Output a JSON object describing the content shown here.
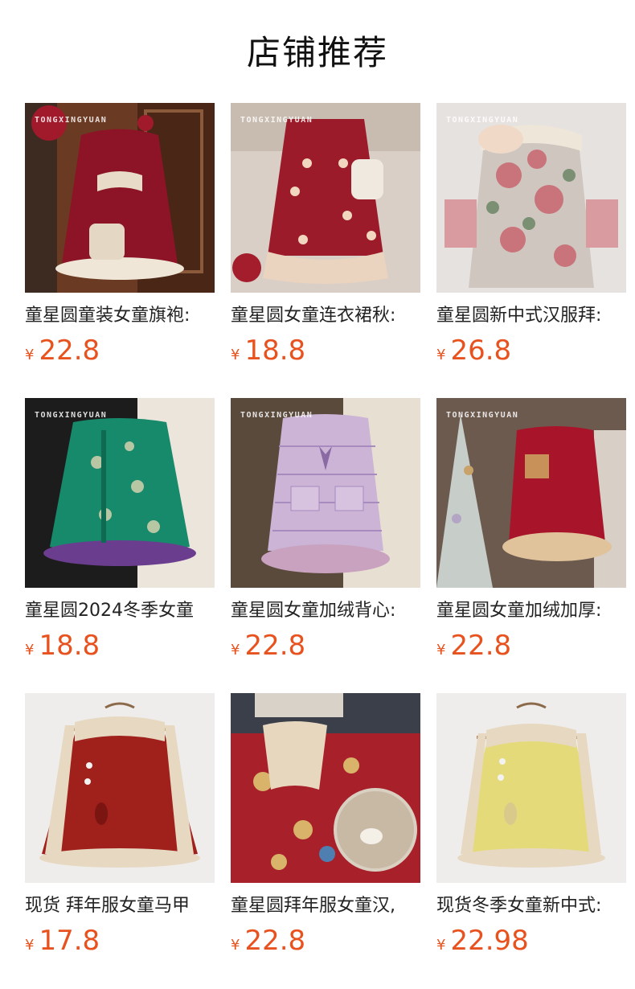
{
  "section_title": "店铺推荐",
  "colors": {
    "price": "#e8521e",
    "text": "#222222"
  },
  "products": [
    {
      "name": "童星圆童装女童旗袍:",
      "currency": "¥",
      "price": "22.8",
      "brand_mark": "TONGXINGYUAN",
      "image": "red-sequin-qipao-vest"
    },
    {
      "name": "童星圆女童连衣裙秋:",
      "currency": "¥",
      "price": "18.8",
      "brand_mark": "TONGXINGYUAN",
      "image": "red-bow-dress"
    },
    {
      "name": "童星圆新中式汉服拜:",
      "currency": "¥",
      "price": "26.8",
      "brand_mark": "TONGXINGYUAN",
      "image": "floral-jacket"
    },
    {
      "name": "童星圆2024冬季女童",
      "currency": "¥",
      "price": "18.8",
      "brand_mark": "TONGXINGYUAN",
      "image": "green-brocade-vest"
    },
    {
      "name": "童星圆女童加绒背心:",
      "currency": "¥",
      "price": "22.8",
      "brand_mark": "TONGXINGYUAN",
      "image": "lilac-tweed-vest"
    },
    {
      "name": "童星圆女童加绒加厚:",
      "currency": "¥",
      "price": "22.8",
      "brand_mark": "TONGXINGYUAN",
      "image": "red-velvet-christmas-dress"
    },
    {
      "name": "现货 拜年服女童马甲",
      "currency": "¥",
      "price": "17.8",
      "brand_mark": "",
      "image": "red-fur-vest"
    },
    {
      "name": "童星圆拜年服女童汉,",
      "currency": "¥",
      "price": "22.8",
      "brand_mark": "",
      "image": "red-floral-hanfu"
    },
    {
      "name": "现货冬季女童新中式:",
      "currency": "¥",
      "price": "22.98",
      "brand_mark": "",
      "image": "yellow-fur-vest"
    }
  ]
}
